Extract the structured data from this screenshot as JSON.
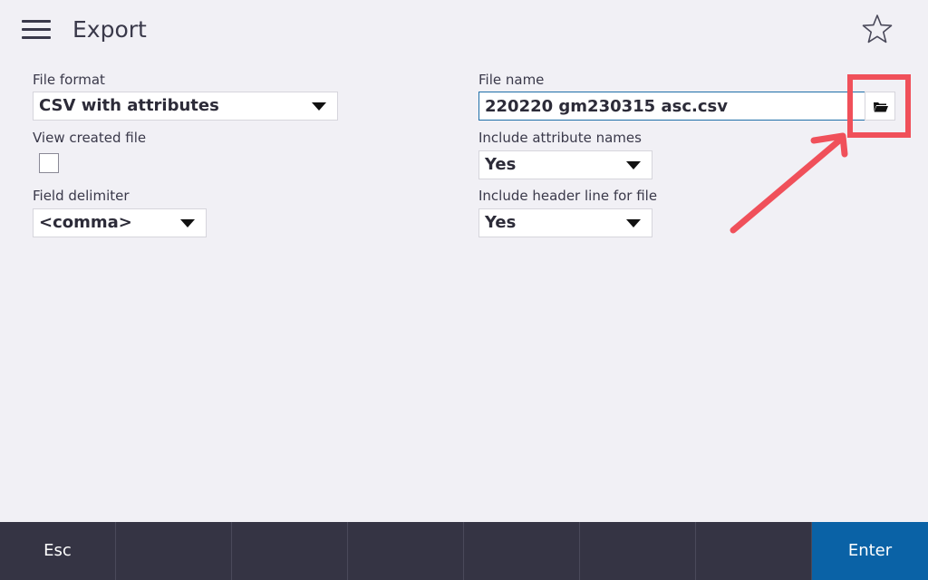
{
  "header": {
    "title": "Export",
    "menu_icon": "hamburger-icon",
    "favorite_icon": "star-icon"
  },
  "left": {
    "file_format": {
      "label": "File format",
      "value": "CSV with attributes"
    },
    "view_created_file": {
      "label": "View created file",
      "checked": false
    },
    "field_delimiter": {
      "label": "Field delimiter",
      "value": "<comma>"
    }
  },
  "right": {
    "file_name": {
      "label": "File name",
      "value": "220220 gm230315 asc.csv",
      "browse_icon": "folder-icon"
    },
    "include_attribute_names": {
      "label": "Include attribute names",
      "value": "Yes"
    },
    "include_header_line": {
      "label": "Include header line for file",
      "value": "Yes"
    }
  },
  "footer": {
    "keys": [
      "Esc",
      "",
      "",
      "",
      "",
      "",
      "",
      "Enter"
    ]
  },
  "colors": {
    "background": "#f1f0f5",
    "footer": "#353444",
    "primary": "#0a62a6",
    "annotation": "#f0505a",
    "input_border": "#1f6fa8"
  }
}
